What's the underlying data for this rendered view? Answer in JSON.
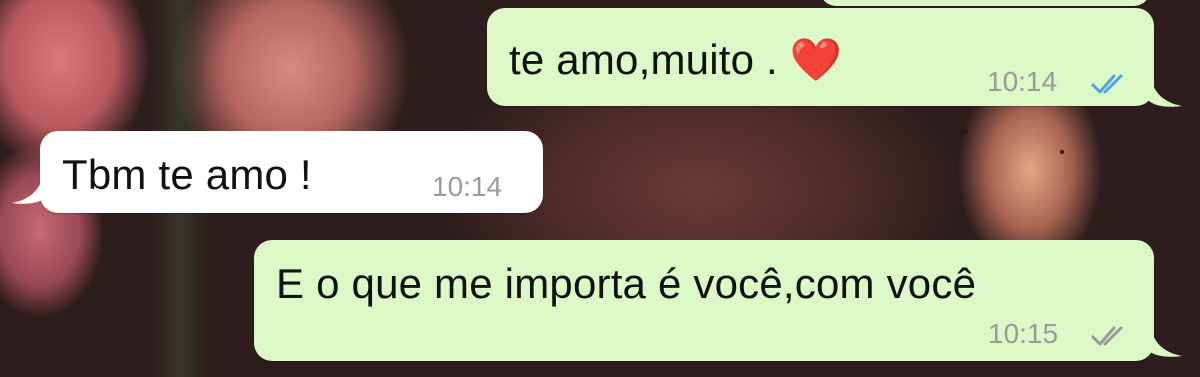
{
  "messages": [
    {
      "direction": "out",
      "text": "te amo,muito . ❤️",
      "time": "10:14",
      "status": "read"
    },
    {
      "direction": "in",
      "text": "Tbm te amo !",
      "time": "10:14"
    },
    {
      "direction": "out",
      "text": "E o que me importa é você,com você",
      "time": "10:15",
      "status": "delivered"
    }
  ],
  "colors": {
    "outgoing_bubble": "#dcf8c6",
    "incoming_bubble": "#ffffff",
    "read_tick": "#4fa3e3",
    "delivered_tick": "#9a9a9a",
    "timestamp": "#9a9a9a"
  }
}
